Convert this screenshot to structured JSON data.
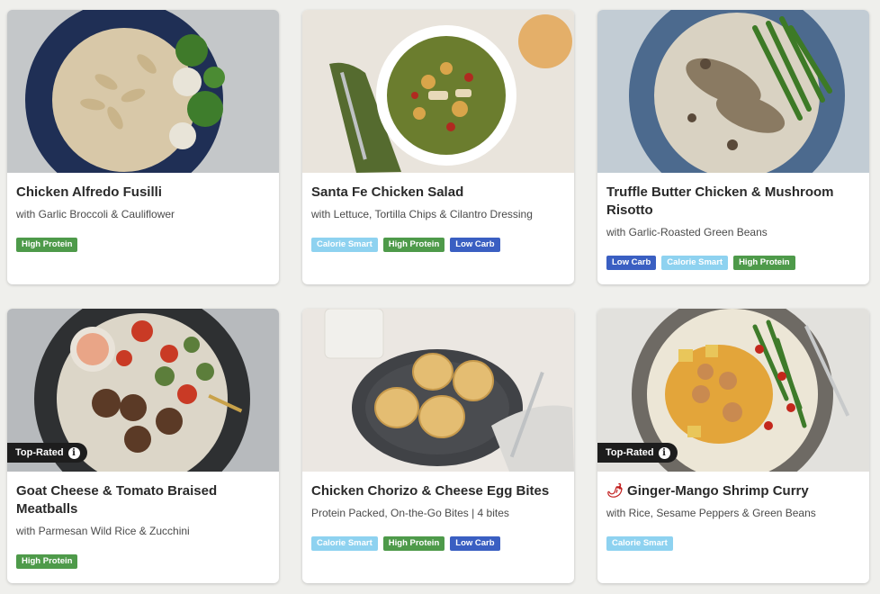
{
  "colors": {
    "calorie_smart": "#8ed2f0",
    "high_protein": "#4e9a4a",
    "low_carb": "#3a5fc2",
    "badge_bg": "#1d1d1d"
  },
  "cards": [
    {
      "title": "Chicken Alfredo Fusilli",
      "subtitle": "with Garlic Broccoli & Cauliflower",
      "tags": [
        "High Protein"
      ],
      "badge": ""
    },
    {
      "title": "Santa Fe Chicken Salad",
      "subtitle": "with Lettuce, Tortilla Chips & Cilantro Dressing",
      "tags": [
        "Calorie Smart",
        "High Protein",
        "Low Carb"
      ],
      "badge": ""
    },
    {
      "title": "Truffle Butter Chicken & Mushroom Risotto",
      "subtitle": "with Garlic-Roasted Green Beans",
      "tags": [
        "Low Carb",
        "Calorie Smart",
        "High Protein"
      ],
      "badge": ""
    },
    {
      "title": "Goat Cheese & Tomato Braised Meatballs",
      "subtitle": "with Parmesan Wild Rice & Zucchini",
      "tags": [
        "High Protein"
      ],
      "badge": "Top-Rated"
    },
    {
      "title": "Chicken Chorizo & Cheese Egg Bites",
      "subtitle": "Protein Packed, On-the-Go Bites | 4 bites",
      "tags": [
        "Calorie Smart",
        "High Protein",
        "Low Carb"
      ],
      "badge": ""
    },
    {
      "title": "Ginger-Mango Shrimp Curry",
      "subtitle": "with Rice, Sesame Peppers & Green Beans",
      "tags": [
        "Calorie Smart"
      ],
      "badge": "Top-Rated",
      "spicy_icon": "chili-pepper-icon"
    }
  ]
}
